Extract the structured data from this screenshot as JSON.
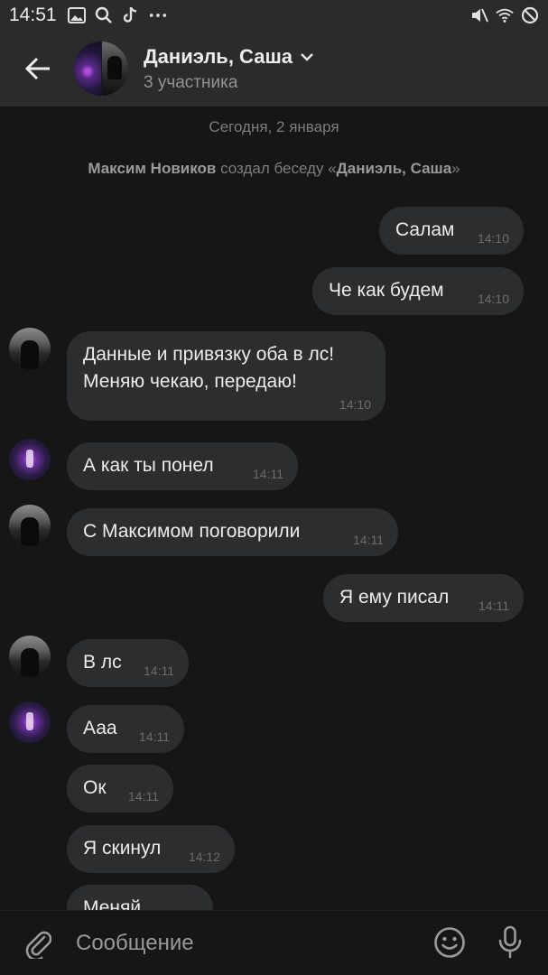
{
  "status_bar": {
    "time": "14:51",
    "icons_left": [
      "gallery-icon",
      "search-icon",
      "tiktok-icon",
      "more-dots-icon"
    ],
    "icons_right": [
      "mute-icon",
      "wifi-icon",
      "do-not-disturb-icon"
    ]
  },
  "header": {
    "title": "Даниэль, Саша",
    "subtitle": "3 участника"
  },
  "chat": {
    "date_separator": "Сегодня, 2 января",
    "system_message": {
      "author": "Максим Новиков",
      "action": " создал беседу «",
      "chat_name": "Даниэль, Саша",
      "closing": "»"
    },
    "messages": [
      {
        "text": "Салам",
        "time": "14:10",
        "from": "outgoing"
      },
      {
        "text": "Че как будем",
        "time": "14:10",
        "from": "outgoing"
      },
      {
        "text": "Данные и привязку оба в лс! Меняю чекаю, передаю!",
        "time": "14:10",
        "from": "incoming",
        "sender": "maxim"
      },
      {
        "text": "А как ты понел",
        "time": "14:11",
        "from": "incoming",
        "sender": "daniel"
      },
      {
        "text": "С Максимом поговорили",
        "time": "14:11",
        "from": "incoming",
        "sender": "maxim"
      },
      {
        "text": "Я ему писал",
        "time": "14:11",
        "from": "outgoing"
      },
      {
        "text": "В лс",
        "time": "14:11",
        "from": "incoming",
        "sender": "maxim"
      },
      {
        "text": "Ааа",
        "time": "14:11",
        "from": "incoming",
        "sender": "daniel"
      },
      {
        "text": "Ок",
        "time": "14:11",
        "from": "incoming",
        "sender": "daniel"
      },
      {
        "text": "Я скинул",
        "time": "14:12",
        "from": "incoming",
        "sender": "daniel"
      },
      {
        "text": "Меняй",
        "time": "",
        "from": "incoming",
        "sender": "daniel"
      }
    ]
  },
  "input": {
    "placeholder": "Сообщение"
  },
  "colors": {
    "background": "#161616",
    "bar": "#2b2b2c",
    "bubble": "#2c2d2e",
    "text": "#ececec",
    "muted": "#7d7d7d"
  }
}
